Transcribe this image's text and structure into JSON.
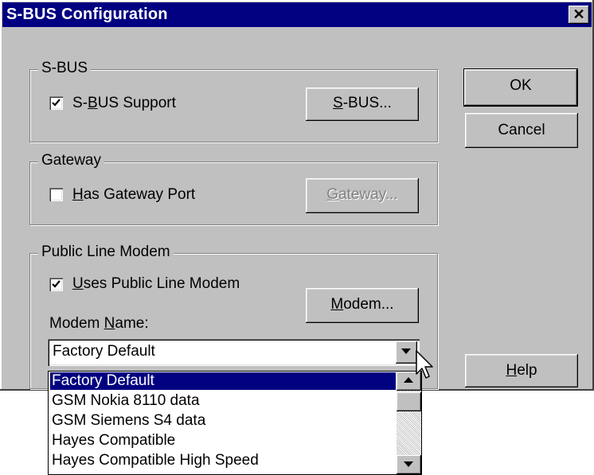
{
  "window": {
    "title": "S-BUS Configuration",
    "close_glyph": "✕"
  },
  "sbus_group": {
    "title": "S-BUS",
    "checkbox": {
      "pre": "S-",
      "accel": "B",
      "post": "US Support",
      "checked": true
    },
    "button": {
      "accel": "S",
      "post": "-BUS..."
    }
  },
  "gateway_group": {
    "title": "Gateway",
    "checkbox": {
      "accel": "H",
      "post": "as Gateway Port",
      "checked": false
    },
    "button": {
      "accel": "G",
      "post": "ateway...",
      "enabled": false
    }
  },
  "modem_group": {
    "title": "Public Line Modem",
    "checkbox": {
      "accel": "U",
      "post": "ses Public Line Modem",
      "checked": true
    },
    "button": {
      "accel": "M",
      "post": "odem..."
    },
    "name_label": {
      "pre": "Modem ",
      "accel": "N",
      "post": "ame:"
    },
    "combo_value": "Factory Default",
    "dropdown_options": [
      "Factory Default",
      "GSM Nokia 8110 data",
      "GSM Siemens S4 data",
      "Hayes Compatible",
      "Hayes Compatible High Speed"
    ],
    "selected_index": 0
  },
  "buttons": {
    "ok": "OK",
    "cancel": "Cancel",
    "help": {
      "accel": "H",
      "post": "elp"
    }
  },
  "colors": {
    "titlebar": "#000080",
    "face": "#c0c0c0",
    "selection": "#000080"
  }
}
